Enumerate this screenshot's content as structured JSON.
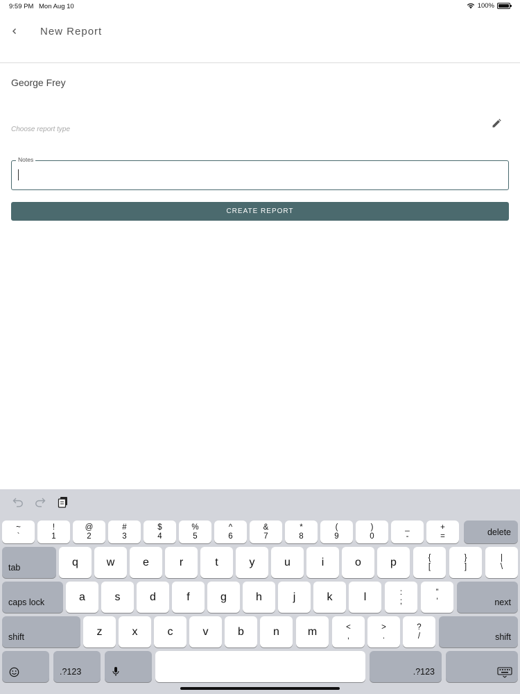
{
  "status_bar": {
    "time": "9:59 PM",
    "date": "Mon Aug 10",
    "battery": "100%",
    "wifi_icon": "wifi-icon"
  },
  "header": {
    "title": "New Report",
    "back_icon": "chevron-left-icon"
  },
  "form": {
    "person_name": "George Frey",
    "report_type_placeholder": "Choose report type",
    "edit_icon": "pencil-icon",
    "notes_label": "Notes",
    "notes_value": "",
    "create_button": "CREATE REPORT"
  },
  "keyboard": {
    "toolbar": {
      "undo_icon": "undo-icon",
      "redo_icon": "redo-icon",
      "paste_icon": "clipboard-icon"
    },
    "number_row": [
      {
        "top": "~",
        "bottom": "`"
      },
      {
        "top": "!",
        "bottom": "1"
      },
      {
        "top": "@",
        "bottom": "2"
      },
      {
        "top": "#",
        "bottom": "3"
      },
      {
        "top": "$",
        "bottom": "4"
      },
      {
        "top": "%",
        "bottom": "5"
      },
      {
        "top": "^",
        "bottom": "6"
      },
      {
        "top": "&",
        "bottom": "7"
      },
      {
        "top": "*",
        "bottom": "8"
      },
      {
        "top": "(",
        "bottom": "9"
      },
      {
        "top": ")",
        "bottom": "0"
      },
      {
        "top": "_",
        "bottom": "-"
      },
      {
        "top": "+",
        "bottom": "="
      }
    ],
    "delete": "delete",
    "tab": "tab",
    "row_q": [
      "q",
      "w",
      "e",
      "r",
      "t",
      "y",
      "u",
      "i",
      "o",
      "p"
    ],
    "row_q_symbols": [
      {
        "top": "{",
        "bottom": "["
      },
      {
        "top": "}",
        "bottom": "]"
      },
      {
        "top": "|",
        "bottom": "\\"
      }
    ],
    "caps_lock": "caps lock",
    "row_a": [
      "a",
      "s",
      "d",
      "f",
      "g",
      "h",
      "j",
      "k",
      "l"
    ],
    "row_a_symbols": [
      {
        "top": ":",
        "bottom": ";"
      },
      {
        "top": "”",
        "bottom": "’"
      }
    ],
    "next": "next",
    "shift": "shift",
    "row_z": [
      "z",
      "x",
      "c",
      "v",
      "b",
      "n",
      "m"
    ],
    "row_z_symbols": [
      {
        "top": "<",
        "bottom": ","
      },
      {
        "top": ">",
        "bottom": "."
      },
      {
        "top": "?",
        "bottom": "/"
      }
    ],
    "emoji_icon": "emoji-icon",
    "numeric_left": ".?123",
    "mic_icon": "microphone-icon",
    "space": "",
    "numeric_right": ".?123",
    "hide_keyboard_icon": "keyboard-hide-icon"
  }
}
